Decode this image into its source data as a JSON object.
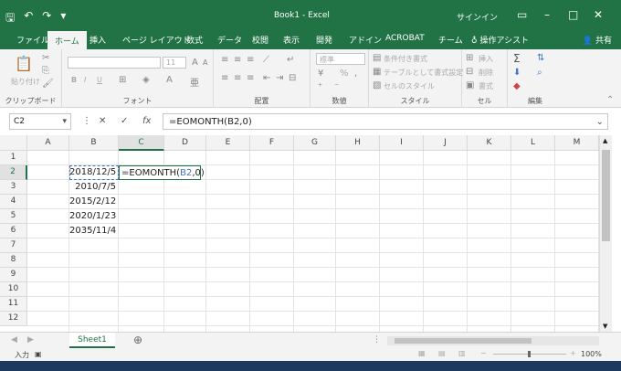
{
  "titlebar": {
    "save_icon": "save-icon",
    "undo_icon": "undo-icon",
    "redo_icon": "redo-icon",
    "title": "Book1 - Excel",
    "signin": "サインイン",
    "bg": "#217346"
  },
  "tabs": {
    "file": "ファイル",
    "home": "ホーム",
    "insert": "挿入",
    "page_layout": "ページ レイアウト",
    "formulas": "数式",
    "data": "データ",
    "review": "校閲",
    "view": "表示",
    "developer": "開発",
    "addins": "アドイン",
    "acrobat": "ACROBAT",
    "team": "チーム",
    "tell_me": "操作アシスト",
    "share": "共有"
  },
  "ribbon": {
    "paste": "貼り付け",
    "clipboard": "クリップボード",
    "font_size": "11",
    "bold": "B",
    "italic": "I",
    "underline": "U",
    "font": "フォント",
    "alignment": "配置",
    "number_format": "標準",
    "percent": "%",
    "number": "数値",
    "conditional_formatting": "条件付き書式",
    "format_as_table": "テーブルとして書式設定",
    "cell_styles": "セルのスタイル",
    "styles": "スタイル",
    "insert": "挿入",
    "delete": "削除",
    "format": "書式",
    "cells": "セル",
    "editing": "編集"
  },
  "formula_bar": {
    "name_box": "C2",
    "cancel": "✕",
    "enter": "✓",
    "fx": "fx",
    "formula": "=EOMONTH(B2,0)"
  },
  "grid": {
    "columns": [
      "A",
      "B",
      "C",
      "D",
      "E",
      "F",
      "G",
      "H",
      "I",
      "J",
      "K",
      "L",
      "M"
    ],
    "rows": [
      "1",
      "2",
      "3",
      "4",
      "5",
      "6",
      "7",
      "8",
      "9",
      "10",
      "11",
      "12"
    ],
    "b_values": [
      "2018/12/5",
      "2010/7/5",
      "2015/2/12",
      "2020/1/23",
      "2035/11/4"
    ],
    "edit_prefix": "=EOMONTH(",
    "edit_ref": "B2",
    "edit_suffix": ",0)"
  },
  "sheets": {
    "active": "Sheet1"
  },
  "status": {
    "mode": "入力",
    "zoom": "100%"
  }
}
